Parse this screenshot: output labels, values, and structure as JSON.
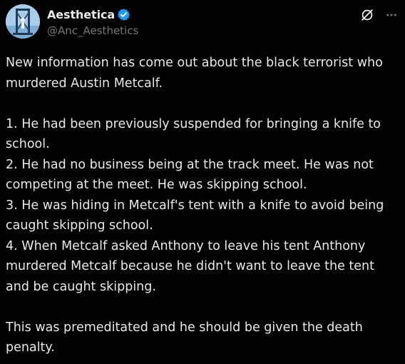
{
  "post": {
    "author": {
      "display_name": "Aesthetica",
      "handle": "@Anc_Aesthetics",
      "verified": true,
      "avatar_icon": "avatar-image"
    },
    "icons": {
      "grok": "grok-icon",
      "more": "more-options-icon",
      "verified": "verified-badge-icon"
    },
    "paragraphs": [
      "New information has come out about the black terrorist who murdered Austin Metcalf."
    ],
    "list_items": [
      "1. He had been previously suspended for bringing a knife to school.",
      "2. He had no business being at the track meet. He was not competing at the meet. He was skipping school.",
      "3. He was hiding in Metcalf's tent with a knife to avoid being caught skipping school.",
      "4. When Metcalf asked Anthony to leave his tent Anthony murdered Metcalf because he didn't want to leave the tent and be caught skipping."
    ],
    "closing": "This was premeditated and he should be given the death penalty."
  },
  "colors": {
    "background": "#000000",
    "text": "#e7e9ea",
    "secondary_text": "#71767b",
    "verified_blue": "#1d9bf0"
  }
}
